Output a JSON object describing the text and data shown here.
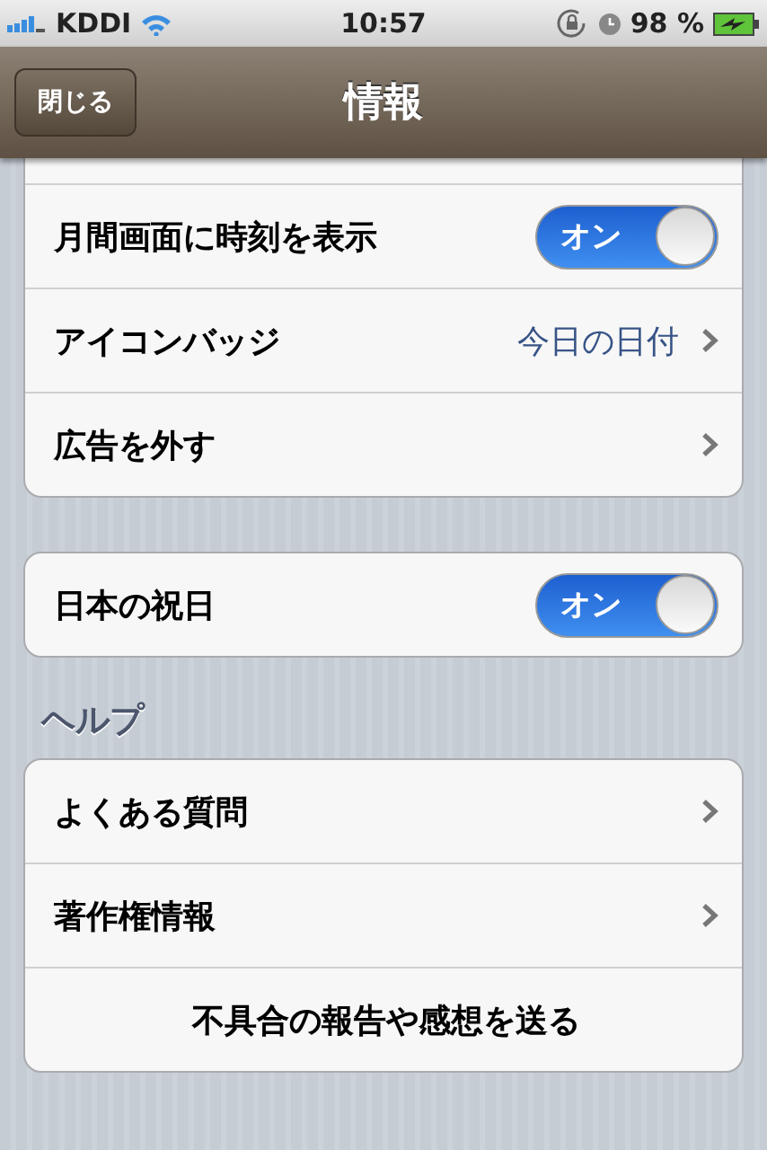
{
  "status_bar": {
    "carrier": "KDDI",
    "time": "10:57",
    "battery": "98 %"
  },
  "nav_bar": {
    "back_button": "閉じる",
    "title": "情報"
  },
  "sections": [
    {
      "rows": [
        {
          "kind": "toggle",
          "label": "月間画面に時刻を表示",
          "switch_text": "オン",
          "on": true
        },
        {
          "kind": "detail",
          "label": "アイコンバッジ",
          "value": "今日の日付"
        },
        {
          "kind": "detail",
          "label": "広告を外す"
        }
      ]
    },
    {
      "rows": [
        {
          "kind": "toggle",
          "label": "日本の祝日",
          "switch_text": "オン",
          "on": true
        }
      ]
    },
    {
      "header": "ヘルプ",
      "rows": [
        {
          "kind": "detail",
          "label": "よくある質問"
        },
        {
          "kind": "detail",
          "label": "著作権情報"
        },
        {
          "kind": "action",
          "label": "不具合の報告や感想を送る"
        }
      ]
    }
  ]
}
